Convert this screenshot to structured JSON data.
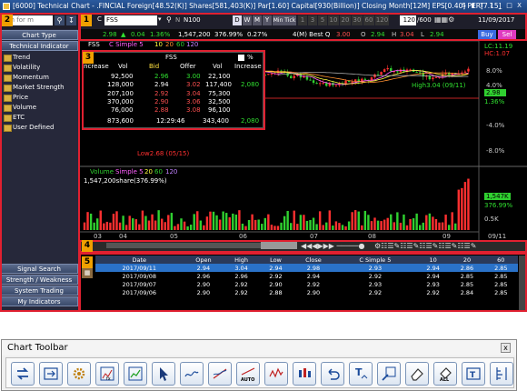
{
  "titlebar": {
    "text": "[6000] Technical Chart - .FINCIAL Foreign[48.52(K)] Shares[581,403(K)] Par[1.60] Capital[930(Billion)] Closing Month[12M] EPS[0.40] PER[7.15]",
    "controls": [
      "S",
      "▮",
      "T",
      "?",
      "_",
      "□",
      "X"
    ]
  },
  "toolbar1": {
    "symbol": "FSS",
    "c_label": "C",
    "prefix": "N",
    "index": "N100",
    "periods": [
      "D",
      "W",
      "M",
      "Y"
    ],
    "min_tick_label": "Min Tick",
    "intervals": [
      "1",
      "3",
      "5",
      "10",
      "20",
      "30",
      "60",
      "120"
    ],
    "count_value": "120",
    "count_total": "/600",
    "date": "11/09/2017"
  },
  "toolbar2": {
    "price": "2.98",
    "change": "0.04",
    "change_pct": "1.36%",
    "volume": "1,547,200",
    "vol_pct": "376.99%",
    "turnover": "0.27%",
    "quote_label": "4(M) Best Q",
    "best_q": "3.00",
    "open_label": "O",
    "open": "2.94",
    "high_label": "H",
    "high": "3.04",
    "low_label": "L",
    "low": "2.94",
    "buy_label": "Buy",
    "sell_label": "Sel"
  },
  "sidebar": {
    "search_placeholder": "rch for m",
    "chart_type": "Chart Type",
    "technical_indicator": "Technical Indicator",
    "items": [
      "Trend",
      "Volatility",
      "Momentum",
      "Market Strength",
      "Price",
      "Volume",
      "ETC",
      "User Defined"
    ],
    "bottom": [
      "Signal Search",
      "Strength / Weakness",
      "System Trading",
      "My Indicators"
    ]
  },
  "callouts": [
    "1",
    "2",
    "3",
    "4",
    "5"
  ],
  "chart": {
    "legend": {
      "symbol": "FSS",
      "ma_label": "C Simple 5",
      "ma": [
        "10",
        "20",
        "60",
        "120"
      ]
    },
    "price_axis": [
      "LC:11.19",
      "HC:1.07",
      "8.0%",
      "4.0%",
      "2.98",
      "1.36%",
      "-4.0%",
      "-8.0%"
    ],
    "high_label": "High3.04 (09/11)",
    "low_label": "Low2.68 (05/15)",
    "volume_legend": {
      "name": "Volume",
      "ma_label": "Simple 5",
      "ma": [
        "20",
        "60",
        "120"
      ]
    },
    "volume_value": "1,547,200share(376.99%)",
    "volume_axis": [
      "1,547K",
      "376.99%",
      "0.5K"
    ],
    "x_axis": [
      "03",
      "04",
      "05",
      "06",
      "07",
      "08",
      "09",
      "09/11"
    ]
  },
  "quote": {
    "symbol": "FSS",
    "pct_label": "%",
    "headers": [
      "Increase",
      "Vol",
      "Bid",
      "Offer",
      "Vol",
      "Increase"
    ],
    "rows": [
      {
        "vol_l": "92,500",
        "bid": "2.96",
        "offer": "3.00",
        "vol_r": "22,100",
        "inc_r": ""
      },
      {
        "vol_l": "128,000",
        "bid": "2.94",
        "offer": "3.02",
        "vol_r": "117,400",
        "inc_r": "2,080"
      },
      {
        "vol_l": "207,100",
        "bid": "2.92",
        "offer": "3.04",
        "vol_r": "75,300",
        "inc_r": ""
      },
      {
        "vol_l": "370,000",
        "bid": "2.90",
        "offer": "3.06",
        "vol_r": "32,500",
        "inc_r": ""
      },
      {
        "vol_l": "76,000",
        "bid": "2.88",
        "offer": "3.08",
        "vol_r": "96,100",
        "inc_r": ""
      }
    ],
    "total_l": "873,600",
    "time": "12:29:46",
    "total_r": "343,400",
    "total_inc": "2,080"
  },
  "grid": {
    "headers": [
      "Date",
      "Open",
      "High",
      "Low",
      "Close",
      "C Simple 5",
      "10",
      "20",
      "60"
    ],
    "rows": [
      [
        "2017/09/11",
        "2.94",
        "3.04",
        "2.94",
        "2.98",
        "2.93",
        "2.94",
        "2.86",
        "2.85"
      ],
      [
        "2017/09/08",
        "2.96",
        "2.96",
        "2.92",
        "2.94",
        "2.92",
        "2.94",
        "2.85",
        "2.85"
      ],
      [
        "2017/09/07",
        "2.90",
        "2.92",
        "2.90",
        "2.92",
        "2.93",
        "2.93",
        "2.85",
        "2.85"
      ],
      [
        "2017/09/06",
        "2.90",
        "2.92",
        "2.88",
        "2.90",
        "2.92",
        "2.92",
        "2.84",
        "2.85"
      ]
    ]
  },
  "panel": {
    "title": "Chart Toolbar",
    "close": "x",
    "tools": [
      "swap-icon",
      "compare-icon",
      "settings-icon",
      "indicator-fx-icon",
      "chart-add-icon",
      "cursor-icon",
      "trend-line-icon",
      "line-icon",
      "auto-trend-icon",
      "wave-icon",
      "candle-icon",
      "undo-icon",
      "text-tool-icon",
      "zoom-icon",
      "eraser-icon",
      "erase-all-icon",
      "text-box-icon",
      "ruler-icon"
    ]
  },
  "colors": {
    "up": "#ff3030",
    "down": "#30d030",
    "accent_red": "#e02030",
    "callout": "#f0a000",
    "selected": "#2a72c8"
  }
}
